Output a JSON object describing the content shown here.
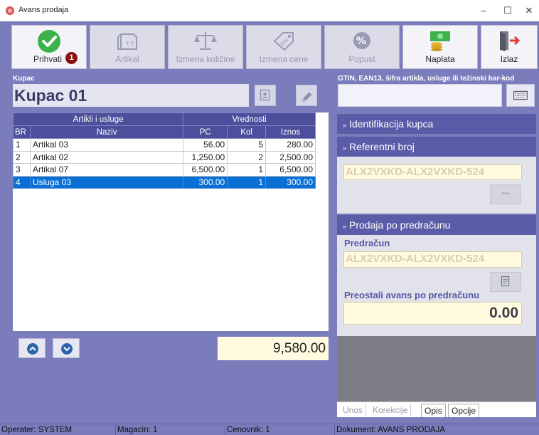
{
  "window": {
    "title": "Avans prodaja",
    "minimize": "–",
    "maximize": "☐",
    "close": "✕"
  },
  "toolbar": {
    "prihvati": {
      "label": "Prihvati",
      "badge": "1",
      "icon": "checkmark-icon"
    },
    "artikal": {
      "label": "Artikal",
      "icon": "box-icon"
    },
    "izmena_kolicine": {
      "label": "Izmena količine",
      "icon": "scale-icon"
    },
    "izmena_cene": {
      "label": "Izmena cene",
      "icon": "price-tag-icon"
    },
    "popust": {
      "label": "Popust",
      "icon": "percent-gear-icon"
    },
    "naplata": {
      "label": "Naplata",
      "icon": "money-icon"
    },
    "izlaz": {
      "label": "Izlaz",
      "icon": "exit-door-icon"
    }
  },
  "customer": {
    "label": "Kupac",
    "value": "Kupac 01"
  },
  "barcode": {
    "label": "GTIN, EAN13, šifra artikla, usluge ili težinski bar-kod",
    "value": ""
  },
  "table": {
    "group_headers": [
      "Artikli i usluge",
      "Vrednosti"
    ],
    "columns": [
      "BR",
      "Naziv",
      "PC",
      "Kol",
      "Iznos"
    ],
    "rows": [
      {
        "br": "1",
        "naziv": "Artikal 03",
        "pc": "56.00",
        "kol": "5",
        "iznos": "280.00"
      },
      {
        "br": "2",
        "naziv": "Artikal 02",
        "pc": "1,250.00",
        "kol": "2",
        "iznos": "2,500.00"
      },
      {
        "br": "3",
        "naziv": "Artikal 07",
        "pc": "6,500.00",
        "kol": "1",
        "iznos": "6,500.00"
      },
      {
        "br": "4",
        "naziv": "Usluga 03",
        "pc": "300.00",
        "kol": "1",
        "iznos": "300.00"
      }
    ],
    "selected_row": 3
  },
  "total": "9,580.00",
  "right_panel": {
    "identifikacija": {
      "header": "Identifikacija kupca",
      "chevron": "»"
    },
    "referentni": {
      "header": "Referentni broj",
      "chevron": "»",
      "value": "ALX2VXKD-ALX2VXKD-524",
      "more_label": "•••"
    },
    "predracun_section": {
      "header": "Prodaja po predračunu",
      "chevron": "»",
      "predracun_label": "Predračun",
      "predracun_value": "ALX2VXKD-ALX2VXKD-524",
      "preostali_label": "Preostali avans po predračunu",
      "preostali_value": "0.00"
    }
  },
  "tabs": [
    "Unos",
    "Korekcije",
    "Opis",
    "Opcije"
  ],
  "active_tab": "Opis",
  "statusbar": {
    "operater": "Operater: SYSTEM",
    "magacin": "Magacin: 1",
    "cenovnik": "Cenovnik: 1",
    "dokument": "Dokument: AVANS PRODAJA"
  },
  "colors": {
    "main_bg": "#7b7cbc",
    "header_bg": "#4c4f9c",
    "selection": "#0a6fd4",
    "badge": "#8b1010",
    "accept_green": "#3cb34a"
  }
}
